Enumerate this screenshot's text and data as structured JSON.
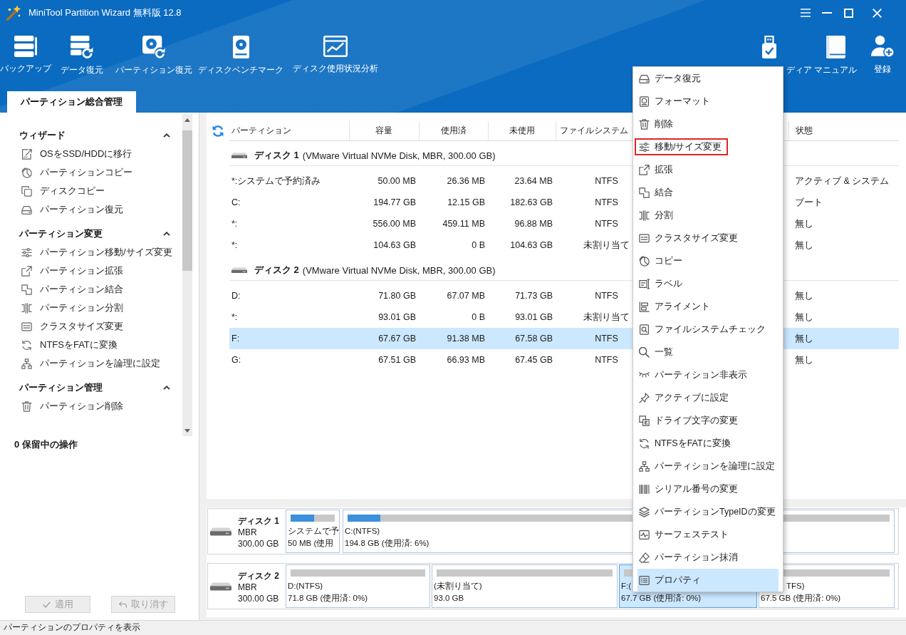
{
  "window": {
    "title": "MiniTool Partition Wizard 無料版 12.8"
  },
  "toolbar": {
    "left": [
      {
        "label": "バックアップ"
      },
      {
        "label": "データ復元"
      },
      {
        "label": "パーティション復元"
      },
      {
        "label": "ディスクベンチマーク"
      },
      {
        "label": "ディスク使用状況分析"
      }
    ],
    "right": [
      {
        "label": "ディア"
      },
      {
        "label": "マニュアル"
      },
      {
        "label": "登録"
      }
    ]
  },
  "tabs": [
    {
      "label": "パーティション総合管理",
      "selected": true
    }
  ],
  "sidebar": {
    "sections": [
      {
        "title": "ウィザード",
        "expanded": true,
        "items": [
          "OSをSSD/HDDに移行",
          "パーティションコピー",
          "ディスクコピー",
          "パーティション復元"
        ]
      },
      {
        "title": "パーティション変更",
        "expanded": true,
        "items": [
          "パーティション移動/サイズ変更",
          "パーティション拡張",
          "パーティション結合",
          "パーティション分割",
          "クラスタサイズ変更",
          "NTFSをFATに変換",
          "パーティションを論理に設定"
        ]
      },
      {
        "title": "パーティション管理",
        "expanded": true,
        "items": [
          "パーティション削除"
        ]
      }
    ],
    "pending": "0 保留中の操作",
    "buttons": [
      {
        "label": "適用",
        "disabled": true
      },
      {
        "label": "取り消す",
        "disabled": true
      }
    ]
  },
  "partition_table": {
    "columns": [
      "パーティション",
      "容量",
      "使用済",
      "未使用",
      "ファイルシステム",
      "状態"
    ],
    "disks": [
      {
        "name": "ディスク 1",
        "detail": "(VMware Virtual NVMe Disk, MBR, 300.00 GB)",
        "rows": [
          {
            "cells": [
              "*:システムで予約済み",
              "50.00 MB",
              "26.36 MB",
              "23.64 MB",
              "NTFS",
              "アクティブ & システム"
            ],
            "selected": false
          },
          {
            "cells": [
              "C:",
              "194.77 GB",
              "12.15 GB",
              "182.63 GB",
              "NTFS",
              "ブート"
            ],
            "selected": false
          },
          {
            "cells": [
              "*:",
              "556.00 MB",
              "459.11 MB",
              "96.88 MB",
              "NTFS",
              "無し"
            ],
            "selected": false
          },
          {
            "cells": [
              "*:",
              "104.63 GB",
              "0 B",
              "104.63 GB",
              "未割り当て",
              "無し"
            ],
            "selected": false
          }
        ]
      },
      {
        "name": "ディスク 2",
        "detail": "(VMware Virtual NVMe Disk, MBR, 300.00 GB)",
        "rows": [
          {
            "cells": [
              "D:",
              "71.80 GB",
              "67.07 MB",
              "71.73 GB",
              "NTFS",
              "無し"
            ],
            "selected": false
          },
          {
            "cells": [
              "*:",
              "93.01 GB",
              "0 B",
              "93.01 GB",
              "未割り当て",
              "無し"
            ],
            "selected": false
          },
          {
            "cells": [
              "F:",
              "67.67 GB",
              "91.38 MB",
              "67.58 GB",
              "NTFS",
              "無し"
            ],
            "selected": true
          },
          {
            "cells": [
              "G:",
              "67.51 GB",
              "66.93 MB",
              "67.45 GB",
              "NTFS",
              "無し"
            ],
            "selected": false
          }
        ]
      }
    ]
  },
  "disk_map": {
    "disks": [
      {
        "name": "ディスク 1",
        "scheme": "MBR",
        "size": "300.00 GB",
        "partitions": [
          {
            "label": "システムで予",
            "info": "50 MB (使用",
            "level": 0.53,
            "selected": false
          },
          {
            "label": "C:(NTFS)",
            "info": "194.8 GB (使用済: 6%)",
            "level": 0.06,
            "selected": false
          }
        ]
      },
      {
        "name": "ディスク 2",
        "scheme": "MBR",
        "size": "300.00 GB",
        "partitions": [
          {
            "label": "D:(NTFS)",
            "info": "71.8 GB (使用済: 0%)",
            "selected": false
          },
          {
            "label": "(未割り当て)",
            "info": "93.0 GB",
            "selected": false
          },
          {
            "label": "F:(",
            "info": "67.7 GB (使用済: 0%)",
            "selected": true
          },
          {
            "label": "TFS)",
            "info": "67.5 GB (使用済: 0%)",
            "selected": false
          }
        ]
      }
    ]
  },
  "context_menu": {
    "items": [
      {
        "label": "データ復元",
        "selected": false,
        "outlined": false
      },
      {
        "label": "フォーマット",
        "selected": false,
        "outlined": false
      },
      {
        "label": "削除",
        "selected": false,
        "outlined": false
      },
      {
        "label": "移動/サイズ変更",
        "selected": false,
        "outlined": true
      },
      {
        "label": "拡張",
        "selected": false,
        "outlined": false
      },
      {
        "label": "結合",
        "selected": false,
        "outlined": false
      },
      {
        "label": "分割",
        "selected": false,
        "outlined": false
      },
      {
        "label": "クラスタサイズ変更",
        "selected": false,
        "outlined": false
      },
      {
        "label": "コピー",
        "selected": false,
        "outlined": false
      },
      {
        "label": "ラベル",
        "selected": false,
        "outlined": false
      },
      {
        "label": "アライメント",
        "selected": false,
        "outlined": false
      },
      {
        "label": "ファイルシステムチェック",
        "selected": false,
        "outlined": false
      },
      {
        "label": "一覧",
        "selected": false,
        "outlined": false
      },
      {
        "label": "パーティション非表示",
        "selected": false,
        "outlined": false
      },
      {
        "label": "アクティブに設定",
        "selected": false,
        "outlined": false
      },
      {
        "label": "ドライブ文字の変更",
        "selected": false,
        "outlined": false
      },
      {
        "label": "NTFSをFATに変換",
        "selected": false,
        "outlined": false
      },
      {
        "label": "パーティションを論理に設定",
        "selected": false,
        "outlined": false
      },
      {
        "label": "シリアル番号の変更",
        "selected": false,
        "outlined": false
      },
      {
        "label": "パーティションTypeIDの変更",
        "selected": false,
        "outlined": false
      },
      {
        "label": "サーフェステスト",
        "selected": false,
        "outlined": false
      },
      {
        "label": "パーティション抹消",
        "selected": false,
        "outlined": false
      },
      {
        "label": "プロパティ",
        "selected": true,
        "outlined": false
      }
    ]
  },
  "status_bar": {
    "text": "パーティションのプロパティを表示"
  }
}
